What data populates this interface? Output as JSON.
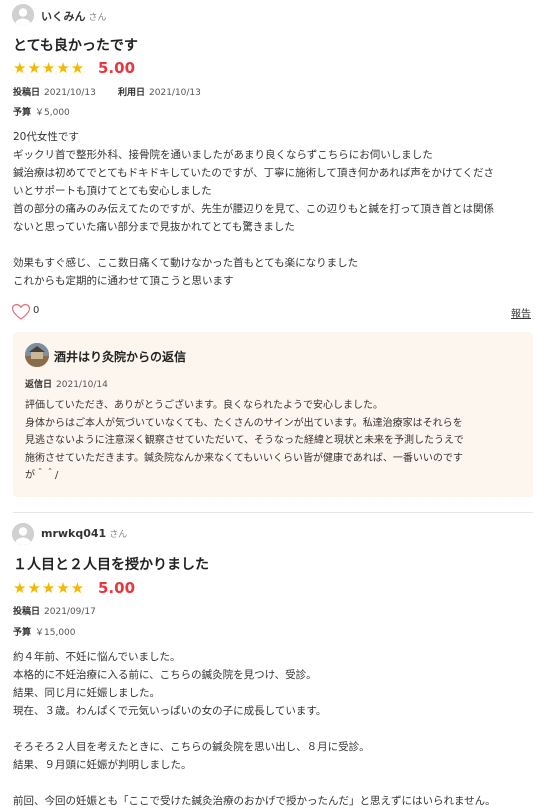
{
  "review1": {
    "username": "いくみん",
    "honorific": "さん",
    "title": "とても良かったです",
    "stars": "★★★★★",
    "score": "5.00",
    "post_date_label": "投稿日",
    "post_date": "2021/10/13",
    "visit_date_label": "利用日",
    "visit_date": "2021/10/13",
    "budget_label": "予算",
    "budget": "￥5,000",
    "body": [
      "20代女性です",
      "ギックリ首で整形外科、接骨院を通いましたがあまり良くならずこちらにお伺いしました",
      "鍼治療は初めてでとてもドキドキしていたのですが、丁寧に施術して頂き何かあれば声をかけてくださ",
      "いとサポートも頂けてとても安心しました",
      "首の部分の痛みのみ伝えてたのですが、先生が腰辺りを見て、この辺りもと鍼を打って頂き首とは関係",
      "ないと思っていた痛い部分まで見抜かれてとても驚きました",
      "",
      "効果もすぐ感じ、ここ数日痛くて動けなかった首もとても楽になりました",
      "これからも定期的に通わせて頂こうと思います"
    ],
    "like_count": "0",
    "report_label": "報告",
    "reply": {
      "shop_name": "酒井はり灸院からの返信",
      "reply_date_label": "返信日",
      "reply_date": "2021/10/14",
      "body": [
        "評価していただき、ありがとうございます。良くなられたようで安心しました。",
        "身体からはご本人が気づいていなくても、たくさんのサインが出ています。私達治療家はそれらを",
        "見逃さないように注意深く観察させていただいて、そうなった経緯と現状と未来を予測したうえで",
        "施術させていただきます。鍼灸院なんか来なくてもいいくらい皆が健康であれば、一番いいのです",
        "が＾＾/"
      ]
    }
  },
  "review2": {
    "username": "mrwkq041",
    "honorific": "さん",
    "title": "１人目と２人目を授かりました",
    "stars": "★★★★★",
    "score": "5.00",
    "post_date_label": "投稿日",
    "post_date": "2021/09/17",
    "budget_label": "予算",
    "budget": "￥15,000",
    "body": [
      "約４年前、不妊に悩んでいました。",
      "本格的に不妊治療に入る前に、こちらの鍼灸院を見つけ、受診。",
      "結果、同じ月に妊娠しました。",
      "現在、３歳。わんぱくで元気いっぱいの女の子に成長しています。",
      "",
      "そろそろ２人目を考えたときに、こちらの鍼灸院を思い出し、８月に受診。",
      "結果、９月頭に妊娠が判明しました。",
      "",
      "前回、今回の妊娠とも「ここで受けた鍼灸治療のおかげで授かったんだ」と思えずにはいられません。"
    ]
  },
  "colors": {
    "star": "#f5b800",
    "score": "#e8383d",
    "reply_bg": "#fdf6ee"
  }
}
